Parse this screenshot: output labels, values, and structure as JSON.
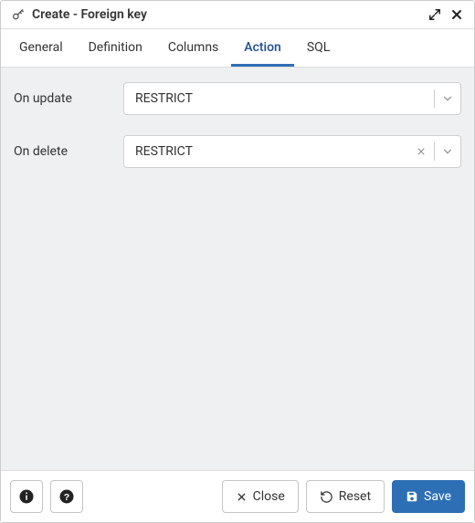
{
  "titlebar": {
    "title": "Create - Foreign key"
  },
  "tabs": [
    {
      "id": "general",
      "label": "General",
      "active": false
    },
    {
      "id": "definition",
      "label": "Definition",
      "active": false
    },
    {
      "id": "columns",
      "label": "Columns",
      "active": false
    },
    {
      "id": "action",
      "label": "Action",
      "active": true
    },
    {
      "id": "sql",
      "label": "SQL",
      "active": false
    }
  ],
  "form": {
    "on_update": {
      "label": "On update",
      "value": "RESTRICT",
      "clearable": false
    },
    "on_delete": {
      "label": "On delete",
      "value": "RESTRICT",
      "clearable": true
    }
  },
  "footer": {
    "close": "Close",
    "reset": "Reset",
    "save": "Save"
  }
}
